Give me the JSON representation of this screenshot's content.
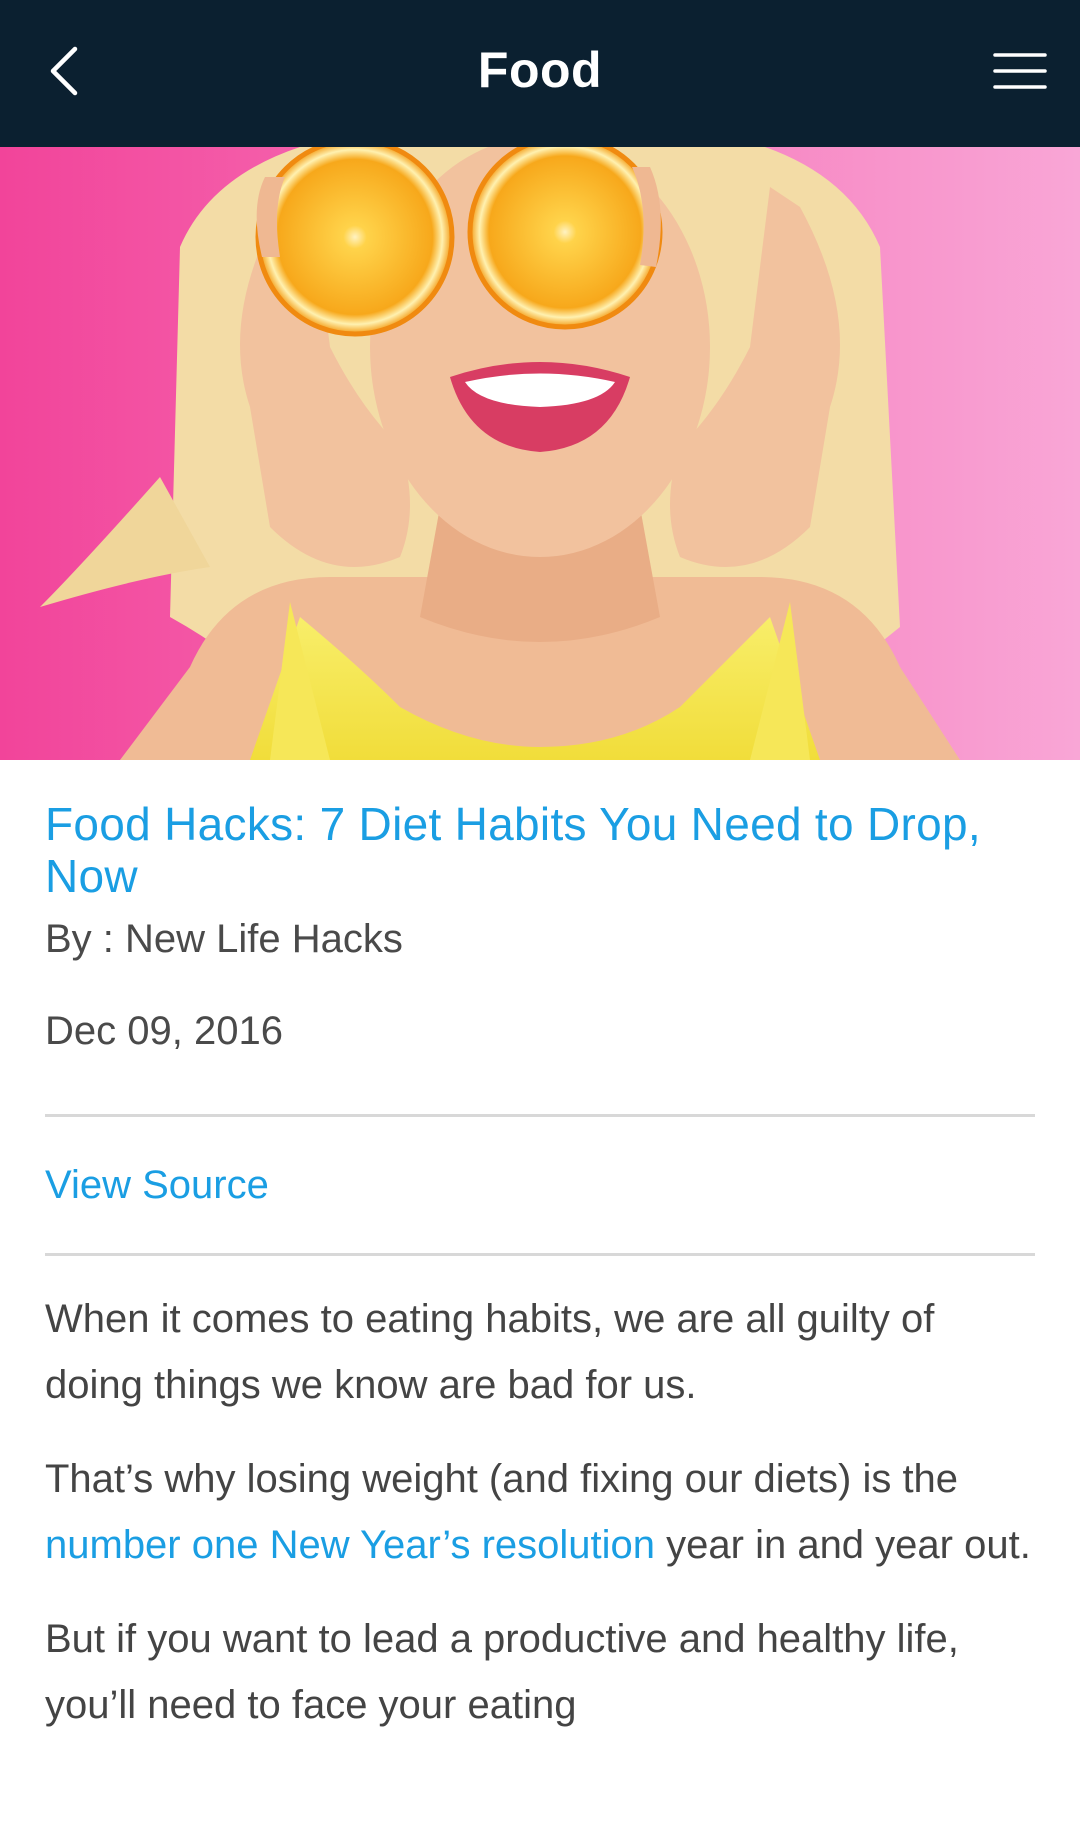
{
  "header": {
    "title": "Food",
    "back_icon": "chevron-left-icon",
    "menu_icon": "hamburger-menu-icon",
    "background_color": "#0b2030"
  },
  "hero": {
    "icon": "hero-image-woman-with-orange-slices"
  },
  "article": {
    "title": "Food Hacks: 7 Diet Habits You Need to Drop, Now",
    "byline": "By : New Life Hacks",
    "date": "Dec 09, 2016",
    "view_source_label": "View Source",
    "paragraph1": "When it comes to eating habits, we are all guilty of doing things we know are bad for us.",
    "paragraph2_before": "That’s why losing weight (and fixing our diets) is the ",
    "paragraph2_link": "number one New Year’s resolution",
    "paragraph2_after": " year in and year out.",
    "paragraph3": "But if you want to lead a productive and healthy life, you’ll need to face your eating"
  },
  "colors": {
    "accent": "#1a9ee3",
    "text": "#444444",
    "divider": "#d8d8d8"
  }
}
